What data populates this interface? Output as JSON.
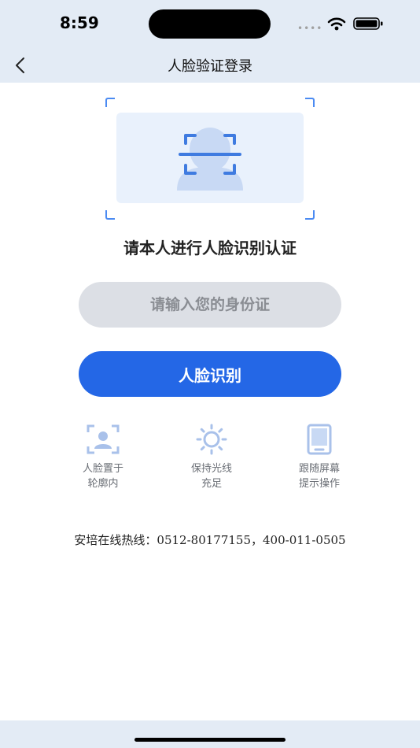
{
  "status_bar": {
    "time": "8:59"
  },
  "header": {
    "title": "人脸验证登录"
  },
  "scan": {
    "prompt": "请本人进行人脸识别认证"
  },
  "form": {
    "id_placeholder": "请输入您的身份证",
    "id_value": "",
    "face_button_label": "人脸识别"
  },
  "tips": [
    {
      "icon": "portrait-frame-icon",
      "line1": "人脸置于",
      "line2": "轮廓内"
    },
    {
      "icon": "sun-icon",
      "line1": "保持光线",
      "line2": "充足"
    },
    {
      "icon": "phone-icon",
      "line1": "跟随屏幕",
      "line2": "提示操作"
    }
  ],
  "footer": {
    "hotline": "安培在线热线：0512-80177155，400-011-0505"
  },
  "colors": {
    "accent": "#2467e6",
    "header_bg": "#e3ebf5",
    "icon": "#a9c1ea"
  }
}
